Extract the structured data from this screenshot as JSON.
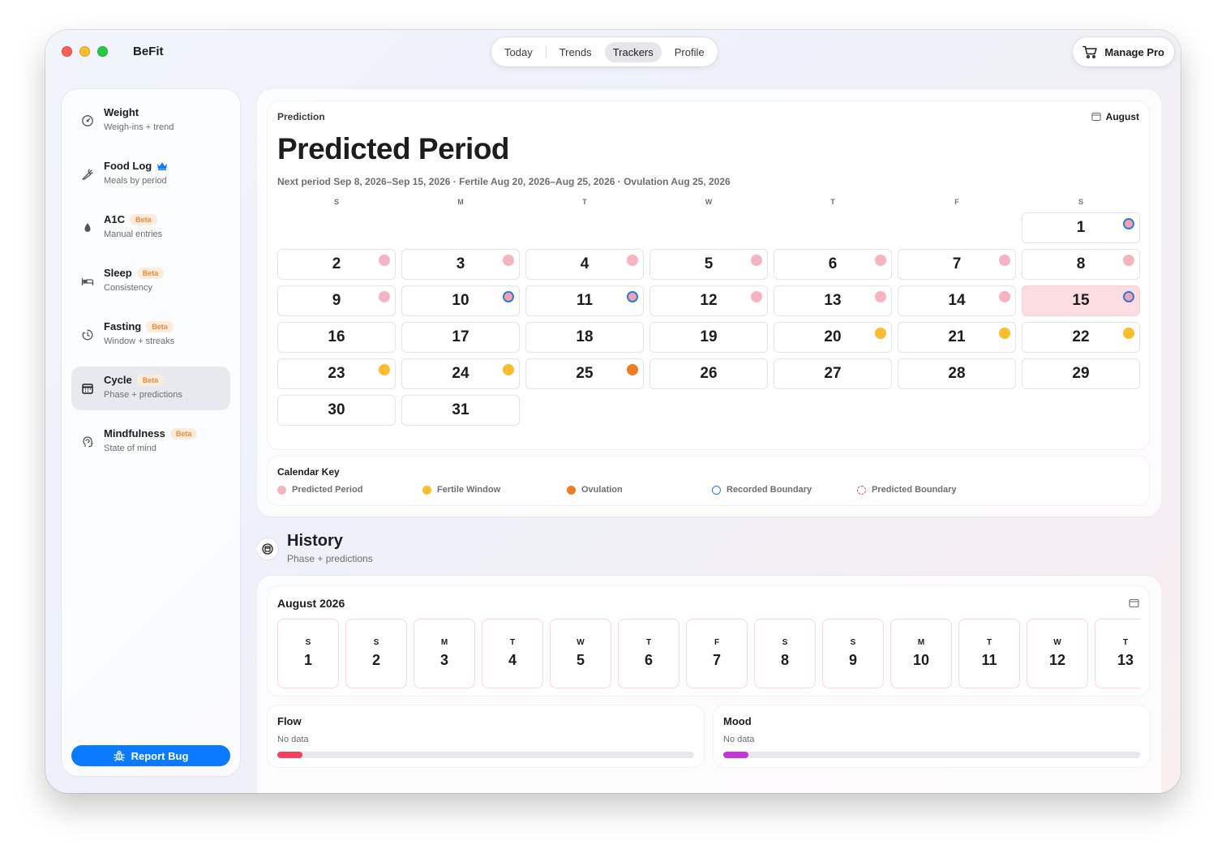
{
  "app": {
    "title": "BeFit"
  },
  "tabs": [
    {
      "label": "Today",
      "active": false
    },
    {
      "label": "Trends",
      "active": false
    },
    {
      "label": "Trackers",
      "active": true
    },
    {
      "label": "Profile",
      "active": false
    }
  ],
  "manage_pro": {
    "label": "Manage Pro",
    "icon": "cart-icon"
  },
  "sidebar": {
    "items": [
      {
        "title": "Weight",
        "subtitle": "Weigh-ins + trend",
        "icon": "gauge-icon",
        "badge": "",
        "crown": false,
        "active": false
      },
      {
        "title": "Food Log",
        "subtitle": "Meals by period",
        "icon": "carrot-icon",
        "badge": "",
        "crown": true,
        "active": false
      },
      {
        "title": "A1C",
        "subtitle": "Manual entries",
        "icon": "drop-icon",
        "badge": "Beta",
        "crown": false,
        "active": false
      },
      {
        "title": "Sleep",
        "subtitle": "Consistency",
        "icon": "bed-icon",
        "badge": "Beta",
        "crown": false,
        "active": false
      },
      {
        "title": "Fasting",
        "subtitle": "Window + streaks",
        "icon": "timer-icon",
        "badge": "Beta",
        "crown": false,
        "active": false
      },
      {
        "title": "Cycle",
        "subtitle": "Phase + predictions",
        "icon": "calendar-icon",
        "badge": "Beta",
        "crown": false,
        "active": true
      },
      {
        "title": "Mindfulness",
        "subtitle": "State of mind",
        "icon": "head-icon",
        "badge": "Beta",
        "crown": false,
        "active": false
      }
    ],
    "report_bug": "Report Bug"
  },
  "prediction": {
    "label": "Prediction",
    "month": "August",
    "title": "Predicted Period",
    "subtitle": "Next period Sep 8, 2026–Sep 15, 2026 · Fertile Aug 20, 2026–Aug 25, 2026 · Ovulation Aug 25, 2026",
    "weekdays": [
      "S",
      "M",
      "T",
      "W",
      "T",
      "F",
      "S"
    ],
    "first_weekday_index": 6,
    "days": [
      {
        "day": "1",
        "marker": "recorded"
      },
      {
        "day": "2",
        "marker": "period"
      },
      {
        "day": "3",
        "marker": "period"
      },
      {
        "day": "4",
        "marker": "period"
      },
      {
        "day": "5",
        "marker": "period"
      },
      {
        "day": "6",
        "marker": "period"
      },
      {
        "day": "7",
        "marker": "period"
      },
      {
        "day": "8",
        "marker": "period"
      },
      {
        "day": "9",
        "marker": "period"
      },
      {
        "day": "10",
        "marker": "recorded"
      },
      {
        "day": "11",
        "marker": "recorded"
      },
      {
        "day": "12",
        "marker": "period"
      },
      {
        "day": "13",
        "marker": "period"
      },
      {
        "day": "14",
        "marker": "period"
      },
      {
        "day": "15",
        "marker": "recorded",
        "highlight": true
      },
      {
        "day": "16",
        "marker": ""
      },
      {
        "day": "17",
        "marker": ""
      },
      {
        "day": "18",
        "marker": ""
      },
      {
        "day": "19",
        "marker": ""
      },
      {
        "day": "20",
        "marker": "fertile"
      },
      {
        "day": "21",
        "marker": "fertile"
      },
      {
        "day": "22",
        "marker": "fertile"
      },
      {
        "day": "23",
        "marker": "fertile"
      },
      {
        "day": "24",
        "marker": "fertile"
      },
      {
        "day": "25",
        "marker": "ovulation"
      },
      {
        "day": "26",
        "marker": ""
      },
      {
        "day": "27",
        "marker": ""
      },
      {
        "day": "28",
        "marker": ""
      },
      {
        "day": "29",
        "marker": ""
      },
      {
        "day": "30",
        "marker": ""
      },
      {
        "day": "31",
        "marker": ""
      }
    ]
  },
  "calendar_key": {
    "title": "Calendar Key",
    "items": [
      {
        "label": "Predicted Period",
        "style": "period"
      },
      {
        "label": "Fertile Window",
        "style": "fertile"
      },
      {
        "label": "Ovulation",
        "style": "ovulation"
      },
      {
        "label": "Recorded Boundary",
        "style": "recorded-ring"
      },
      {
        "label": "Predicted Boundary",
        "style": "predicted-ring"
      }
    ]
  },
  "history": {
    "title": "History",
    "subtitle": "Phase + predictions",
    "month_label": "August 2026",
    "strip": [
      {
        "w": "S",
        "n": "1"
      },
      {
        "w": "S",
        "n": "2"
      },
      {
        "w": "M",
        "n": "3"
      },
      {
        "w": "T",
        "n": "4"
      },
      {
        "w": "W",
        "n": "5"
      },
      {
        "w": "T",
        "n": "6"
      },
      {
        "w": "F",
        "n": "7"
      },
      {
        "w": "S",
        "n": "8"
      },
      {
        "w": "S",
        "n": "9"
      },
      {
        "w": "M",
        "n": "10"
      },
      {
        "w": "T",
        "n": "11"
      },
      {
        "w": "W",
        "n": "12"
      },
      {
        "w": "T",
        "n": "13"
      }
    ]
  },
  "stats": {
    "flow": {
      "title": "Flow",
      "value": "No data",
      "bar_fraction": 0.06,
      "color": "#f2405e"
    },
    "mood": {
      "title": "Mood",
      "value": "No data",
      "bar_fraction": 0.06,
      "color": "#c236d9"
    }
  },
  "colors": {
    "accent": "#0a7aff",
    "period": "#f6b4c0",
    "fertile": "#fbbd2e",
    "ovulation": "#f27c22",
    "recorded_ring": "#2a7ed9",
    "predicted_ring": "#e0475e",
    "highlight_day": "#fbdde1"
  }
}
